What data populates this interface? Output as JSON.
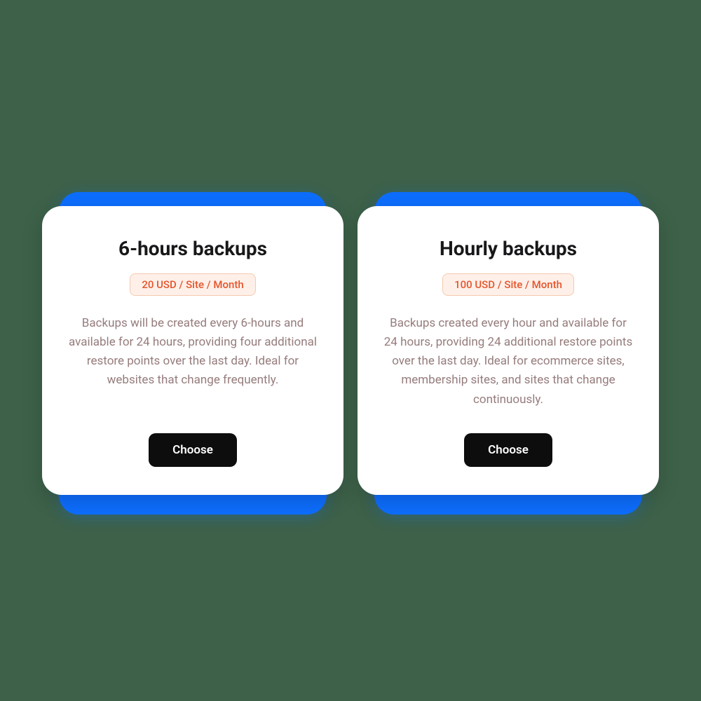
{
  "cards": [
    {
      "title": "6-hours backups",
      "price": "20 USD / Site / Month",
      "description": "Backups will be created every 6-hours and available for 24 hours, providing four additional restore points over the last day. Ideal for websites that change frequently.",
      "button": "Choose"
    },
    {
      "title": "Hourly backups",
      "price": "100 USD / Site / Month",
      "description": "Backups created every hour and available for 24 hours, providing 24 additional restore points over the last day. Ideal for ecommerce sites, membership sites, and sites that change continuously.",
      "button": "Choose"
    }
  ]
}
